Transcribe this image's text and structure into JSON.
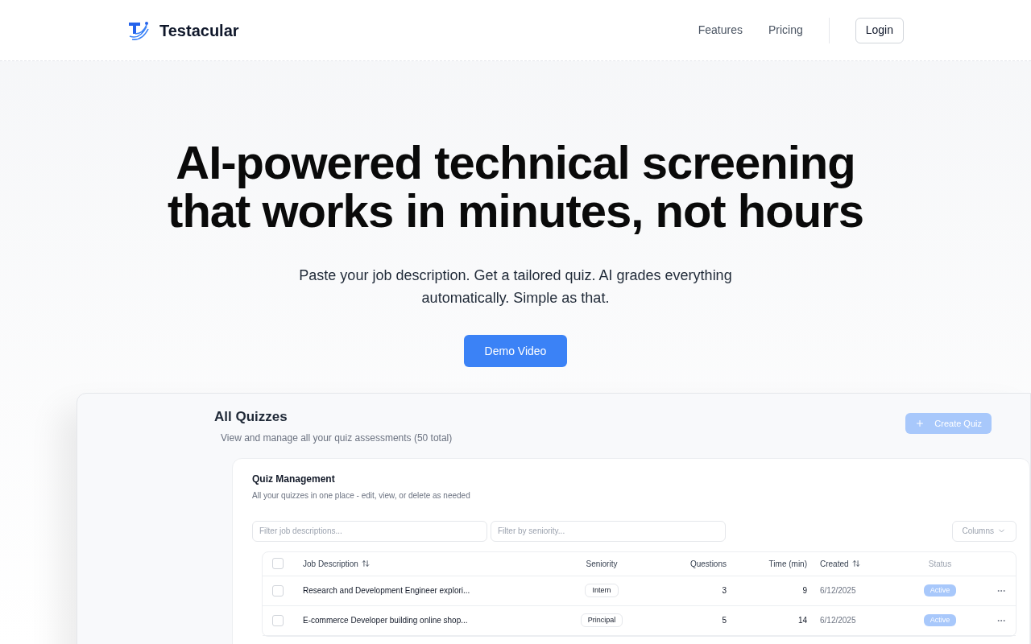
{
  "nav": {
    "brand": "Testacular",
    "links": [
      "Features",
      "Pricing"
    ],
    "login": "Login"
  },
  "hero": {
    "title_lines": [
      "AI-powered technical screening",
      "that works in minutes, not hours"
    ],
    "subtitle": "Paste your job description. Get a tailored quiz. AI grades everything automatically. Simple as that.",
    "cta": "Demo Video"
  },
  "preview": {
    "title": "All Quizzes",
    "subtitle": "View and manage all your quiz assessments (50 total)",
    "create_button": "Create Quiz",
    "card": {
      "title": "Quiz Management",
      "subtitle": "All your quizzes in one place - edit, view, or delete as needed",
      "filters": [
        {
          "placeholder": "Filter job descriptions..."
        },
        {
          "placeholder": "Filter by seniority..."
        }
      ],
      "columns_button": "Columns",
      "table": {
        "header_checked": false,
        "columns": [
          {
            "label": "Job Description",
            "sortable": true
          },
          {
            "label": "Seniority",
            "sortable": false
          },
          {
            "label": "Questions",
            "sortable": false
          },
          {
            "label": "Time (min)",
            "sortable": false
          },
          {
            "label": "Created",
            "sortable": true
          },
          {
            "label": "Status",
            "sortable": false
          }
        ],
        "rows": [
          {
            "checked": false,
            "job": "Research and Development Engineer explori...",
            "seniority": "Intern",
            "questions": "3",
            "time": "9",
            "created": "6/12/2025",
            "status": "Active"
          },
          {
            "checked": false,
            "job": "E-commerce Developer building online shop...",
            "seniority": "Principal",
            "questions": "5",
            "time": "14",
            "created": "6/12/2025",
            "status": "Active"
          }
        ]
      }
    }
  }
}
